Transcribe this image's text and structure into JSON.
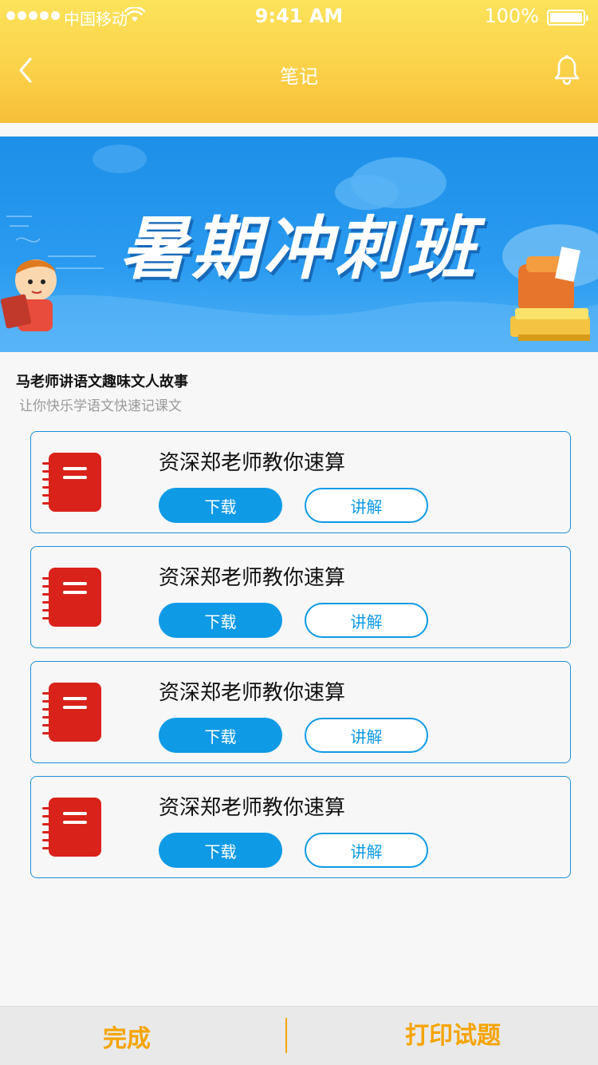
{
  "status_bar": {
    "carrier": "中国移动",
    "time": "9:41 AM",
    "battery": "100%"
  },
  "nav": {
    "title": "笔记",
    "back_icon": "chevron-left-icon",
    "bell_icon": "bell-icon"
  },
  "banner": {
    "text": "暑期冲刺班"
  },
  "course": {
    "title": "马老师讲语文趣味文人故事",
    "subtitle": "让你快乐学语文快速记课文"
  },
  "items": [
    {
      "title": "资深郑老师教你速算",
      "download_label": "下载",
      "explain_label": "讲解"
    },
    {
      "title": "资深郑老师教你速算",
      "download_label": "下载",
      "explain_label": "讲解"
    },
    {
      "title": "资深郑老师教你速算",
      "download_label": "下载",
      "explain_label": "讲解"
    },
    {
      "title": "资深郑老师教你速算",
      "download_label": "下载",
      "explain_label": "讲解"
    }
  ],
  "bottom_bar": {
    "done_label": "完成",
    "print_label": "打印试题"
  },
  "colors": {
    "accent_blue": "#0f9ae6",
    "header_yellow": "#fbd24a",
    "notebook_red": "#d9221a",
    "bottom_orange": "#f5a400"
  }
}
